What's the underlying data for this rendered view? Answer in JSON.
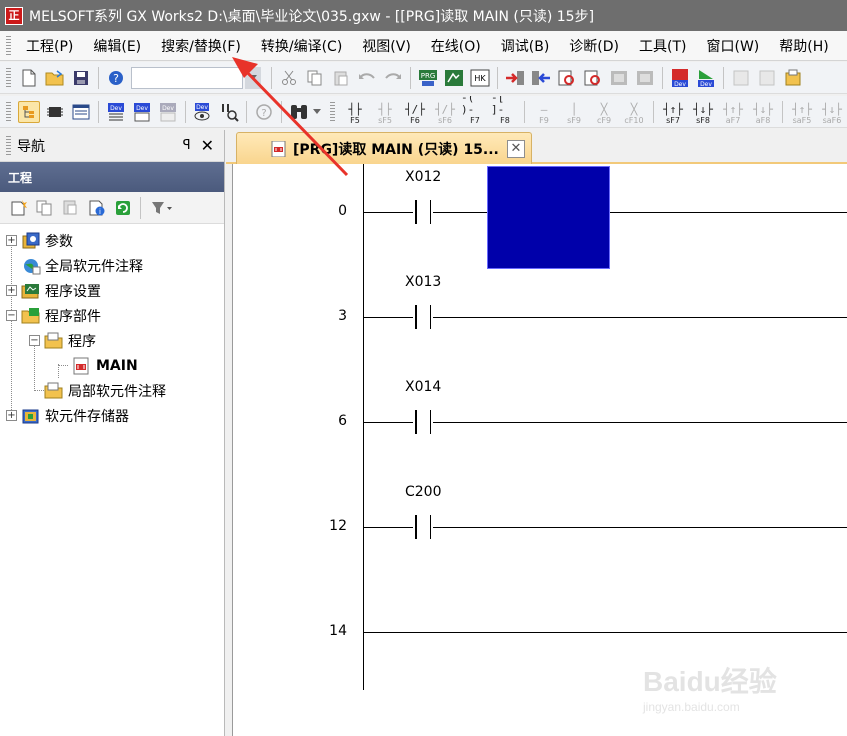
{
  "window": {
    "title": "MELSOFT系列 GX Works2 D:\\桌面\\毕业论文\\035.gxw - [[PRG]读取 MAIN (只读) 15步]",
    "icon_text": "正",
    "app_icon_color": "#cc1a1a"
  },
  "menu": {
    "items": [
      {
        "label": "工程(P)"
      },
      {
        "label": "编辑(E)"
      },
      {
        "label": "搜索/替换(F)"
      },
      {
        "label": "转换/编译(C)"
      },
      {
        "label": "视图(V)"
      },
      {
        "label": "在线(O)"
      },
      {
        "label": "调试(B)"
      },
      {
        "label": "诊断(D)"
      },
      {
        "label": "工具(T)"
      },
      {
        "label": "窗口(W)"
      },
      {
        "label": "帮助(H)"
      }
    ]
  },
  "toolbar2": {
    "fkeys": [
      {
        "sym": "┤├",
        "label": "F5",
        "dim": false
      },
      {
        "sym": "┤├",
        "label": "sF5",
        "dim": true
      },
      {
        "sym": "┤/├",
        "label": "F6",
        "dim": false
      },
      {
        "sym": "┤/├",
        "label": "sF6",
        "dim": true
      },
      {
        "sym": "-( )-",
        "label": "F7",
        "dim": false
      },
      {
        "sym": "-[ ]-",
        "label": "F8",
        "dim": false
      },
      {
        "sym": "—",
        "label": "F9",
        "dim": true
      },
      {
        "sym": "│",
        "label": "sF9",
        "dim": true
      },
      {
        "sym": "╳",
        "label": "cF9",
        "dim": true
      },
      {
        "sym": "╳",
        "label": "cF10",
        "dim": true
      },
      {
        "sym": "┤↑├",
        "label": "sF7",
        "dim": false
      },
      {
        "sym": "┤↓├",
        "label": "sF8",
        "dim": false
      },
      {
        "sym": "┤↑├",
        "label": "aF7",
        "dim": true
      },
      {
        "sym": "┤↓├",
        "label": "aF8",
        "dim": true
      },
      {
        "sym": "┤↑├",
        "label": "saF5",
        "dim": true
      },
      {
        "sym": "┤↓├",
        "label": "saF6",
        "dim": true
      }
    ]
  },
  "nav": {
    "title": "导航",
    "pin_icon": "pin-icon",
    "close_label": "✕",
    "pin_label": "ꟼ",
    "section_label": "工程",
    "tree": [
      {
        "label": "参数",
        "toggle": "+",
        "depth": 0,
        "icon": "parameter-icon"
      },
      {
        "label": "全局软元件注释",
        "toggle": "",
        "depth": 0,
        "icon": "global-comment-icon"
      },
      {
        "label": "程序设置",
        "toggle": "+",
        "depth": 0,
        "icon": "program-setting-icon"
      },
      {
        "label": "程序部件",
        "toggle": "−",
        "depth": 0,
        "icon": "program-parts-icon"
      },
      {
        "label": "程序",
        "toggle": "−",
        "depth": 1,
        "icon": "program-folder-icon"
      },
      {
        "label": "MAIN",
        "toggle": "",
        "depth": 2,
        "icon": "ladder-program-icon",
        "selected": true
      },
      {
        "label": "局部软元件注释",
        "toggle": "",
        "depth": 1,
        "icon": "local-comment-icon"
      },
      {
        "label": "软元件存储器",
        "toggle": "+",
        "depth": 0,
        "icon": "device-memory-icon"
      }
    ]
  },
  "editor": {
    "tab_label": "[PRG]读取 MAIN (只读) 15...",
    "tab_close": "✕",
    "rungs": [
      {
        "step": "0",
        "device": "X012"
      },
      {
        "step": "3",
        "device": "X013"
      },
      {
        "step": "6",
        "device": "X014"
      },
      {
        "step": "12",
        "device": "C200"
      },
      {
        "step": "14",
        "device": ""
      }
    ],
    "cursor_color": "#0000aa"
  },
  "annotation": {
    "arrow_color": "#e8332a"
  },
  "watermark": {
    "logo": "Baidu经验",
    "url": "jingyan.baidu.com"
  }
}
